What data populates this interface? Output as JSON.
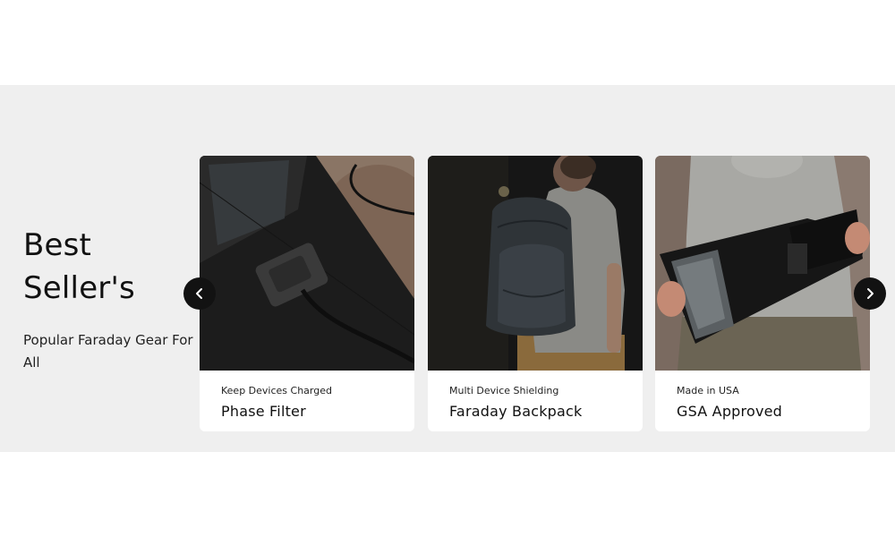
{
  "section": {
    "heading_line1": "Best",
    "heading_line2": "Seller's",
    "tagline": "Popular Faraday Gear For All"
  },
  "carousel": {
    "prev_icon": "chevron-left-icon",
    "next_icon": "chevron-right-icon",
    "cards": [
      {
        "subtitle": "Keep Devices Charged",
        "title": "Phase Filter",
        "image": "phase-filter-photo"
      },
      {
        "subtitle": "Multi Device Shielding",
        "title": "Faraday Backpack",
        "image": "faraday-backpack-photo"
      },
      {
        "subtitle": "Made in USA",
        "title": "GSA Approved",
        "image": "faraday-sleeve-photo"
      }
    ]
  },
  "colors": {
    "section_bg": "#efefef",
    "card_bg": "#ffffff",
    "nav_button": "#121212"
  }
}
